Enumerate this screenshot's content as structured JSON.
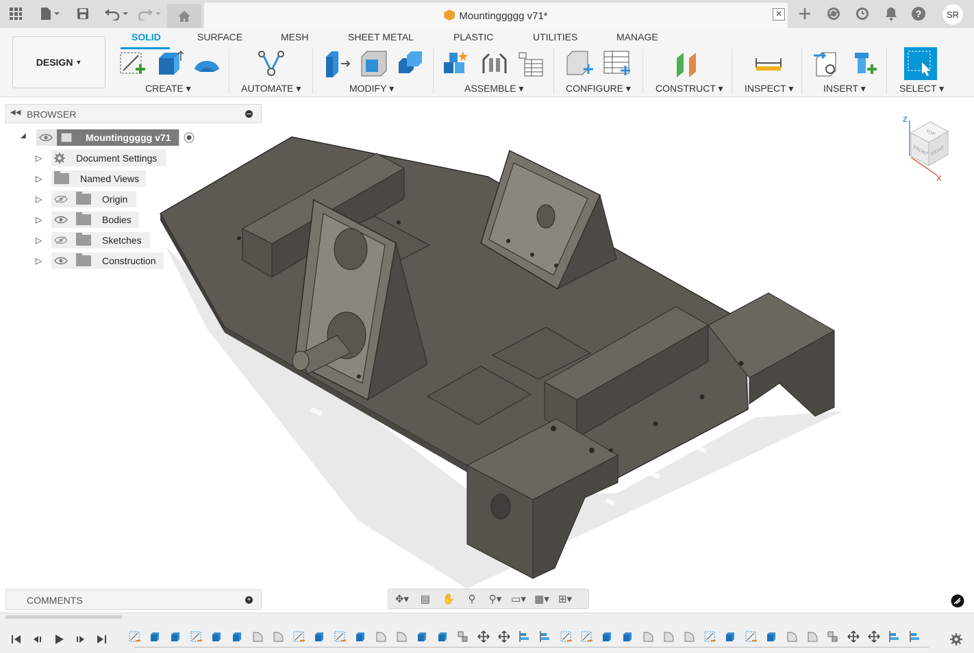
{
  "window": {
    "document_title": "Mountinggggg v71*",
    "user_initials": "SR"
  },
  "ribbon": {
    "workspace_label": "DESIGN",
    "tabs": [
      "SOLID",
      "SURFACE",
      "MESH",
      "SHEET METAL",
      "PLASTIC",
      "UTILITIES",
      "MANAGE"
    ],
    "active_tab": "SOLID",
    "groups": [
      "CREATE",
      "AUTOMATE",
      "MODIFY",
      "ASSEMBLE",
      "CONFIGURE",
      "CONSTRUCT",
      "INSPECT",
      "INSERT",
      "SELECT"
    ],
    "accent_color": "#0696d7"
  },
  "browser": {
    "title": "BROWSER",
    "root": "Mountinggggg v71",
    "items": [
      {
        "label": "Document Settings",
        "icon": "gear-icon",
        "visibility": "none"
      },
      {
        "label": "Named Views",
        "icon": "folder-icon",
        "visibility": "none"
      },
      {
        "label": "Origin",
        "icon": "folder-icon",
        "visibility": "hidden"
      },
      {
        "label": "Bodies",
        "icon": "folder-icon",
        "visibility": "visible"
      },
      {
        "label": "Sketches",
        "icon": "folder-icon",
        "visibility": "hidden"
      },
      {
        "label": "Construction",
        "icon": "folder-icon",
        "visibility": "visible"
      }
    ]
  },
  "comments": {
    "title": "COMMENTS"
  },
  "viewcube": {
    "faces": [
      "TOP",
      "FRONT",
      "RIGHT"
    ],
    "axes": [
      "Z",
      "X"
    ]
  },
  "navbar": {
    "tools": [
      "orbit-icon",
      "look-at-icon",
      "pan-icon",
      "zoom-icon",
      "zoom-window-icon",
      "display-settings-icon",
      "grid-icon",
      "viewports-icon"
    ]
  },
  "timeline": {
    "controls": [
      "go-to-start",
      "step-back",
      "play",
      "step-forward",
      "go-to-end"
    ],
    "feature_count": 39
  }
}
